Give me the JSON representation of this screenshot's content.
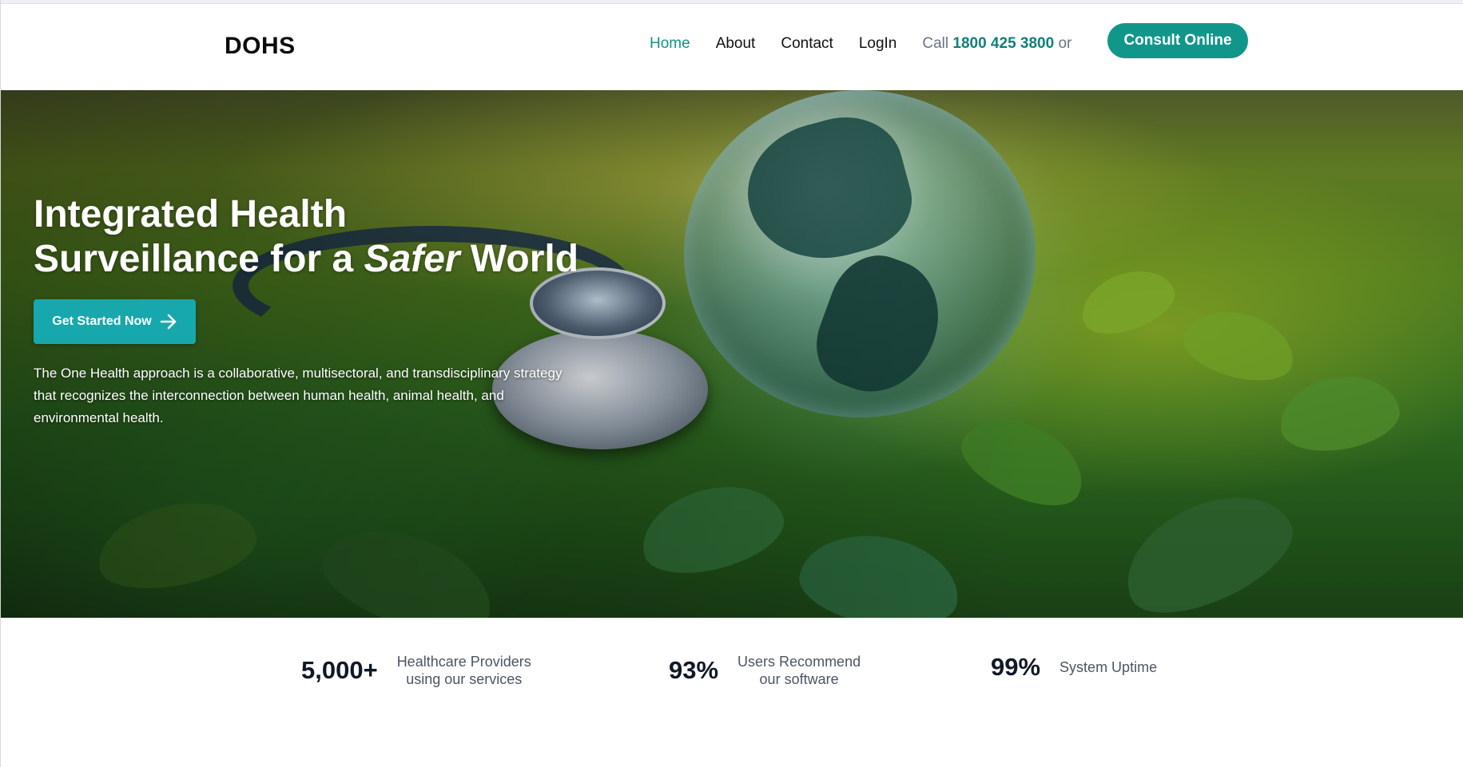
{
  "header": {
    "logo": "DOHS",
    "nav": [
      {
        "label": "Home",
        "active": true
      },
      {
        "label": "About",
        "active": false
      },
      {
        "label": "Contact",
        "active": false
      },
      {
        "label": "LogIn",
        "active": false
      }
    ],
    "call_prefix": "Call",
    "phone": "1800 425 3800",
    "call_suffix": "or",
    "consult_label": "Consult Online"
  },
  "hero": {
    "title_line1": "Integrated Health",
    "title_line2_prefix": "Surveillance for a ",
    "title_line2_emphasis": "Safer",
    "title_line2_suffix": " World",
    "cta_label": "Get Started Now",
    "cta_icon": "arrow-right-icon",
    "description": "The One Health approach is a collaborative, multisectoral, and transdisciplinary strategy that recognizes the interconnection between human health, animal health, and environmental health."
  },
  "stats": [
    {
      "value": "5,000+",
      "label": "Healthcare Providers\nusing our services"
    },
    {
      "value": "93%",
      "label": "Users Recommend\nour software"
    },
    {
      "value": "99%",
      "label": "System Uptime"
    }
  ],
  "colors": {
    "accent_teal": "#11968a",
    "active_nav": "#149187",
    "cta": "#17a8ad"
  }
}
